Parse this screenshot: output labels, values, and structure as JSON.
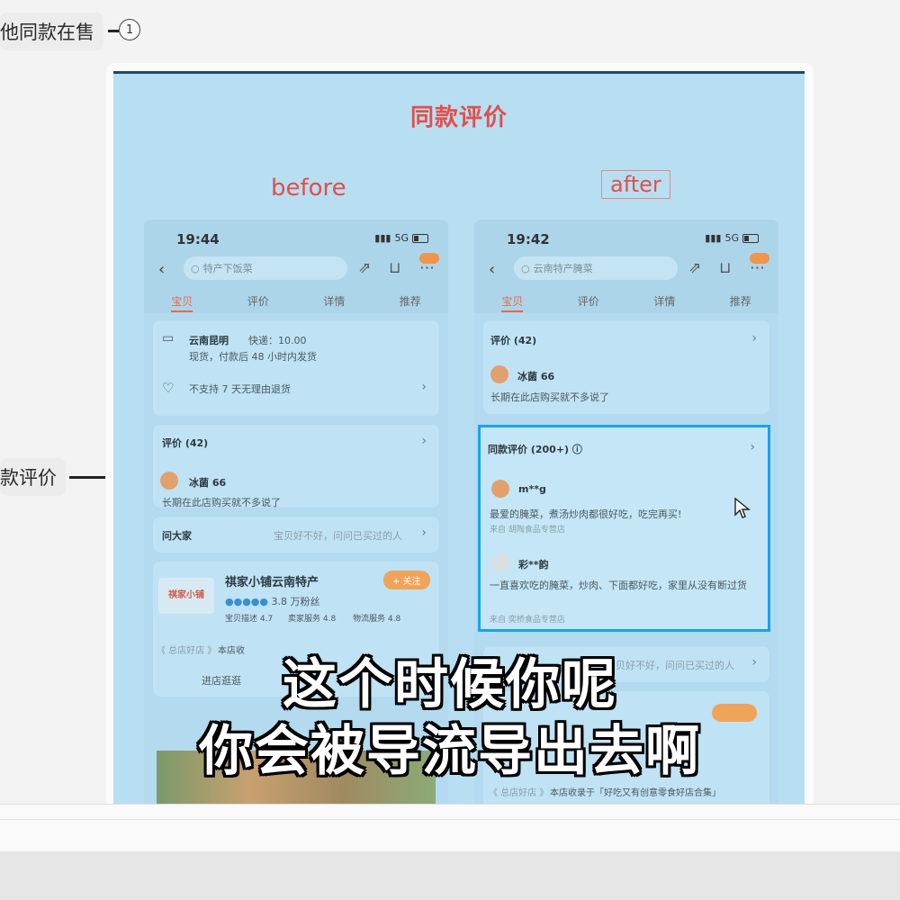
{
  "mindmap": {
    "node_top_label": "他同款在售",
    "node_top_number": "1",
    "node_mid_label": "款评价"
  },
  "slide": {
    "title": "同款评价",
    "before_label": "before",
    "after_label": "after"
  },
  "before_phone": {
    "time": "19:44",
    "signal": "5G",
    "search_placeholder": "特产下饭菜",
    "tabs": [
      "宝贝",
      "评价",
      "详情",
      "推荐"
    ],
    "ship_origin": "云南昆明",
    "ship_fee": "快递：10.00",
    "ship_note": "现货，付款后 48 小时内发货",
    "return_policy": "不支持 7 天无理由退货",
    "reviews_header": "评价 (42)",
    "reviewer": "冰菌 66",
    "review_text": "长期在此店购买就不多说了",
    "ask_label": "问大家",
    "ask_hint": "宝贝好不好，问问已买过的人",
    "shop_name": "祺家小铺云南特产",
    "follow_label": "+ 关注",
    "shop_fans": "3.8 万粉丝",
    "shop_scores": [
      "宝贝描述 4.7",
      "卖家服务 4.8",
      "物流服务 4.8"
    ],
    "shop_logo_text": "祺家小铺",
    "shop_collection_note": "本店收",
    "shop_tag": "《 总店好店 》",
    "enter_shop": "进店逛逛"
  },
  "after_phone": {
    "time": "19:42",
    "signal": "5G",
    "search_placeholder": "云南特产腌菜",
    "tabs": [
      "宝贝",
      "评价",
      "详情",
      "推荐"
    ],
    "reviews_header": "评价 (42)",
    "reviewer": "冰菌 66",
    "review_text": "长期在此店购买就不多说了",
    "same_reviews_header": "同款评价 (200+)",
    "same_reviewer_1": "m**g",
    "same_review_1": "最爱的腌菜，煮汤炒肉都很好吃，吃完再买!",
    "same_source_1": "来自 胡陶食品专营店",
    "same_reviewer_2": "彩**韵",
    "same_review_2": "一直喜欢吃的腌菜，炒肉、下面都好吃，家里从没有断过货",
    "same_source_2": "来自 奕桥食品专营店",
    "ask_hint": "宝贝好不好，问问已买过的人",
    "shop_tag": "《 总店好店 》",
    "shop_collection_note": "本店收录于「好吃又有创意零食好店合集」"
  },
  "caption": {
    "line1": "这个时候你呢",
    "line2": "你会被导流导出去啊"
  },
  "colors": {
    "accent_red": "#e0504b",
    "highlight_blue": "#1aa3e6",
    "slide_bg": "#b8def2"
  }
}
